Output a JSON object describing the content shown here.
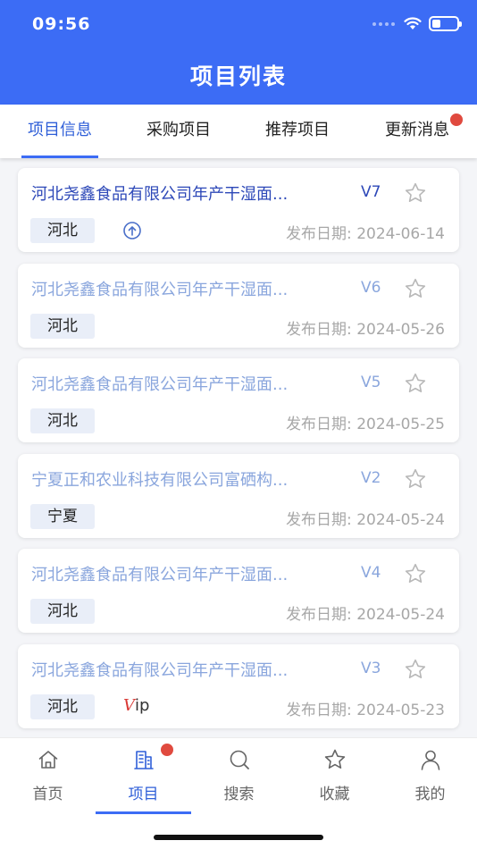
{
  "status_bar": {
    "time": "09:56"
  },
  "header": {
    "title": "项目列表"
  },
  "tabs": [
    {
      "label": "项目信息",
      "active": true,
      "badge": false
    },
    {
      "label": "采购项目",
      "active": false,
      "badge": false
    },
    {
      "label": "推荐项目",
      "active": false,
      "badge": false
    },
    {
      "label": "更新消息",
      "active": false,
      "badge": true
    }
  ],
  "projects": [
    {
      "title": "河北尧鑫食品有限公司年产干湿面...",
      "version": "V7",
      "region": "河北",
      "date_label": "发布日期: 2024-06-14",
      "unread": true,
      "extra": "upload-icon"
    },
    {
      "title": "河北尧鑫食品有限公司年产干湿面...",
      "version": "V6",
      "region": "河北",
      "date_label": "发布日期: 2024-05-26",
      "unread": false,
      "extra": ""
    },
    {
      "title": "河北尧鑫食品有限公司年产干湿面...",
      "version": "V5",
      "region": "河北",
      "date_label": "发布日期: 2024-05-25",
      "unread": false,
      "extra": ""
    },
    {
      "title": "宁夏正和农业科技有限公司富硒构...",
      "version": "V2",
      "region": "宁夏",
      "date_label": "发布日期: 2024-05-24",
      "unread": false,
      "extra": ""
    },
    {
      "title": "河北尧鑫食品有限公司年产干湿面...",
      "version": "V4",
      "region": "河北",
      "date_label": "发布日期: 2024-05-24",
      "unread": false,
      "extra": ""
    },
    {
      "title": "河北尧鑫食品有限公司年产干湿面...",
      "version": "V3",
      "region": "河北",
      "date_label": "发布日期: 2024-05-23",
      "unread": false,
      "extra": "vip",
      "vip_v": "V",
      "vip_rest": "ip"
    }
  ],
  "tabbar": [
    {
      "label": "首页",
      "icon": "home-icon",
      "active": false
    },
    {
      "label": "项目",
      "icon": "building-icon",
      "active": true,
      "badge": true
    },
    {
      "label": "搜索",
      "icon": "search-icon",
      "active": false
    },
    {
      "label": "收藏",
      "icon": "star-icon",
      "active": false
    },
    {
      "label": "我的",
      "icon": "user-icon",
      "active": false
    }
  ],
  "colors": {
    "primary": "#3c6cf5",
    "unread_title": "#2d48b8",
    "read_title": "#8aa6dd",
    "badge": "#e04a3f"
  }
}
